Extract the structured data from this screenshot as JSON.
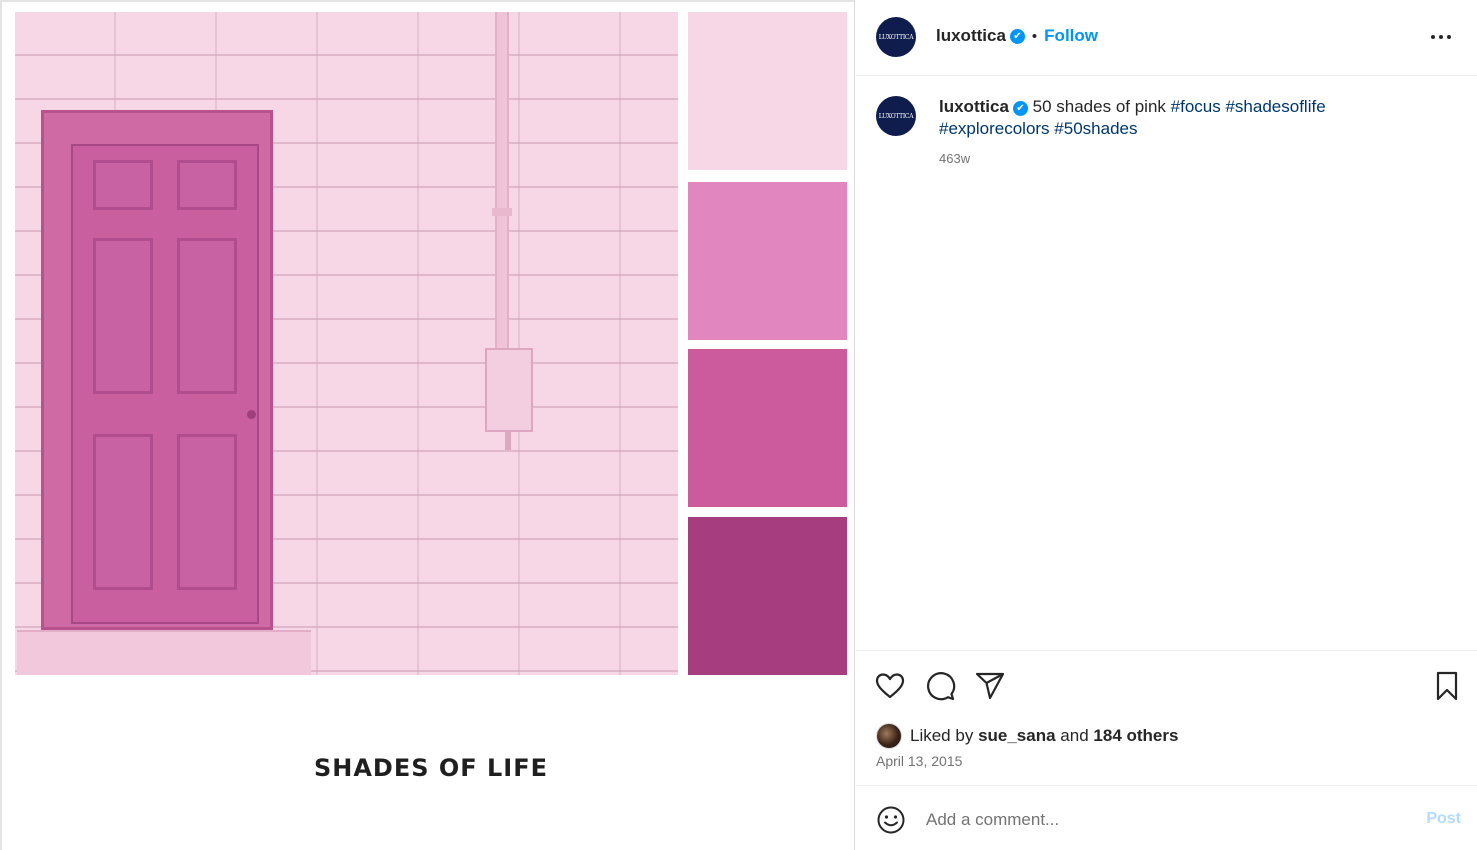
{
  "post": {
    "image_caption_text": "SHADES OF LIFE",
    "swatches": [
      "#f7d6e5",
      "#e286bf",
      "#cb5b9d",
      "#a63d7e"
    ]
  },
  "header": {
    "avatar_text": "LUXOTTICA",
    "username": "luxottica",
    "verified_icon": "✔",
    "separator": "•",
    "follow_label": "Follow",
    "more_icon": "more-dots-icon"
  },
  "caption": {
    "avatar_text": "LUXOTTICA",
    "username": "luxottica",
    "verified_icon": "✔",
    "text": "50 shades of pink",
    "hashtags": [
      "#focus",
      "#shadesoflife",
      "#explorecolors",
      "#50shades"
    ],
    "time_ago": "463w"
  },
  "actions": {
    "icons": [
      "heart-icon",
      "comment-icon",
      "share-icon",
      "bookmark-icon"
    ],
    "liked_prefix": "Liked by",
    "liked_user": "sue_sana",
    "liked_and": "and",
    "liked_others": "184 others",
    "date": "April 13, 2015"
  },
  "comment": {
    "emoji_icon": "emoji-smile-icon",
    "placeholder": "Add a comment...",
    "post_label": "Post"
  },
  "colors": {
    "accent": "#0095f6",
    "hashtag": "#00376b",
    "avatar_bg": "#0f1d4e"
  }
}
